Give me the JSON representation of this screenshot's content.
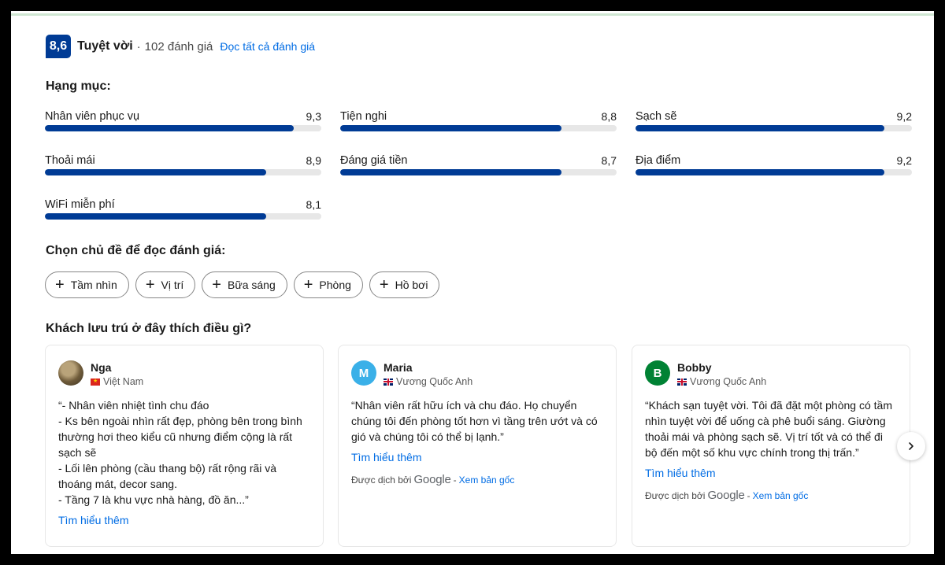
{
  "summary": {
    "score": "8,6",
    "rating_word": "Tuyệt vời",
    "review_count": "102 đánh giá",
    "read_all_label": "Đọc tất cả đánh giá"
  },
  "categories": {
    "title": "Hạng mục:",
    "items": [
      {
        "label": "Nhân viên phục vụ",
        "score": "9,3",
        "fill": 0.9
      },
      {
        "label": "Tiện nghi",
        "score": "8,8",
        "fill": 0.8
      },
      {
        "label": "Sạch sẽ",
        "score": "9,2",
        "fill": 0.9
      },
      {
        "label": "Thoải mái",
        "score": "8,9",
        "fill": 0.8
      },
      {
        "label": "Đáng giá tiền",
        "score": "8,7",
        "fill": 0.8
      },
      {
        "label": "Địa điểm",
        "score": "9,2",
        "fill": 0.9
      },
      {
        "label": "WiFi miễn phí",
        "score": "8,1",
        "fill": 0.8
      }
    ]
  },
  "topics": {
    "title": "Chọn chủ đề để đọc đánh giá:",
    "chips": [
      "Tầm nhìn",
      "Vị trí",
      "Bữa sáng",
      "Phòng",
      "Hồ bơi"
    ]
  },
  "guests": {
    "title": "Khách lưu trú ở đây thích điều gì?",
    "cards": [
      {
        "name": "Nga",
        "country": "Việt Nam",
        "avatar_text": "",
        "text": "“- Nhân viên nhiệt tình chu đáo\n- Ks bên ngoài nhìn rất đẹp, phòng bên trong bình thường hơi theo kiểu cũ nhưng điểm cộng là rất sạch sẽ\n- Lối lên phòng (cầu thang bộ) rất rộng rãi và thoáng mát, decor sang.\n- Tầng 7 là khu vực nhà hàng, đồ ăn...”",
        "read_more": "Tìm hiểu thêm"
      },
      {
        "name": "Maria",
        "country": "Vương Quốc Anh",
        "avatar_text": "M",
        "text": "“Nhân viên rất hữu ích và chu đáo. Họ chuyển chúng tôi đến phòng tốt hơn vì tầng trên ướt và có gió và chúng tôi có thể bị lạnh.”",
        "read_more": "Tìm hiểu thêm",
        "translated_by": "Được dịch bởi",
        "google": "Google",
        "view_original": "Xem bản gốc"
      },
      {
        "name": "Bobby",
        "country": "Vương Quốc Anh",
        "avatar_text": "B",
        "text": "“Khách sạn tuyệt vời. Tôi đã đặt một phòng có tầm nhìn tuyệt vời để uống cà phê buổi sáng. Giường thoải mái và phòng sạch sẽ. Vị trí tốt và có thể đi bộ đến một số khu vực chính trong thị trấn.”",
        "read_more": "Tìm hiểu thêm",
        "translated_by": "Được dịch bởi",
        "google": "Google",
        "view_original": "Xem bản gốc"
      }
    ]
  },
  "icons": {
    "chip_icon": "plus-icon",
    "next": "chevron-right-icon",
    "flags": [
      "vietnam-flag-icon",
      "uk-flag-icon",
      "uk-flag-icon"
    ]
  },
  "colors": {
    "brand": "#003b95",
    "link": "#006ce4",
    "track": "#e7e7e7",
    "avatar_m": "#3ab0e8",
    "avatar_b": "#008234"
  }
}
